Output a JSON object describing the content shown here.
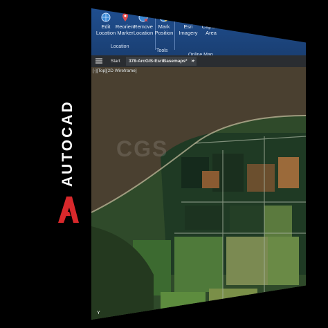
{
  "brand": {
    "name": "AUTOCAD",
    "logo_letter": "A"
  },
  "ribbon": {
    "buttons": [
      {
        "label": "Edit\nLocation",
        "icon": "globe-icon"
      },
      {
        "label": "Reorient\nMarker",
        "icon": "map-marker-icon"
      },
      {
        "label": "Remove\nLocation",
        "icon": "globe-remove-icon"
      },
      {
        "label": "Mark\nPosition",
        "icon": "globe-mark-icon"
      },
      {
        "label": "Esri Imagery",
        "icon": "imagery-icon"
      },
      {
        "label": "Capture\nArea",
        "icon": "capture-icon"
      }
    ],
    "groups": {
      "location": "Location",
      "tools": "Tools",
      "online_map": "Online Map"
    }
  },
  "tabs": {
    "start": "Start",
    "active": "378-ArcGIS-EsriBasemaps*",
    "close": "×",
    "add": "+"
  },
  "viewport": {
    "label": "[-][Top][2D Wireframe]",
    "axis_y": "Y",
    "watermark": "CGS"
  },
  "colors": {
    "ribbon": "#1f4e8f",
    "brand_red": "#d8282b"
  }
}
